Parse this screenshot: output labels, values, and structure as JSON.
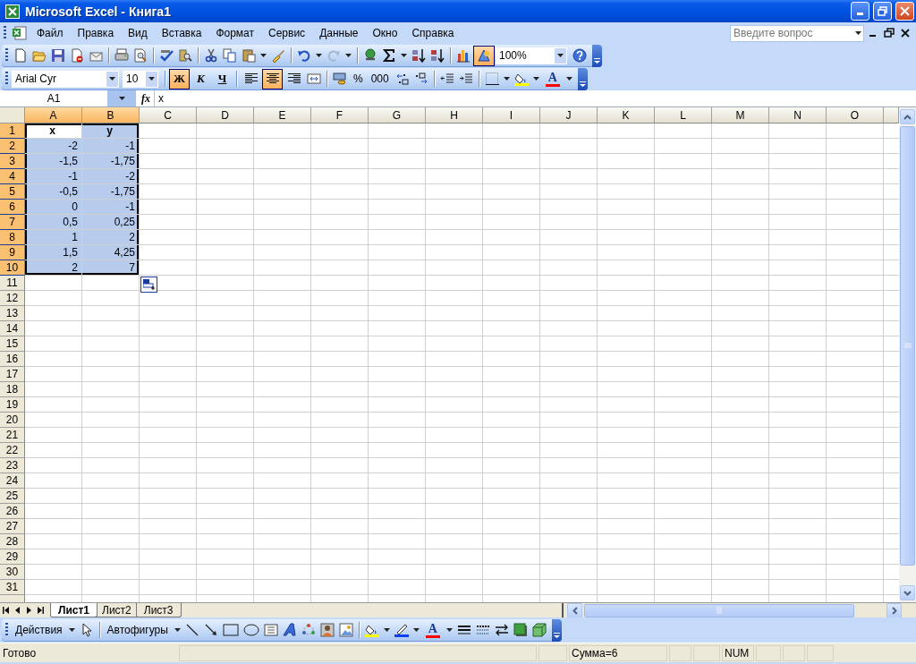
{
  "window": {
    "title": "Microsoft Excel - Книга1"
  },
  "menu": {
    "items": [
      "Файл",
      "Правка",
      "Вид",
      "Вставка",
      "Формат",
      "Сервис",
      "Данные",
      "Окно",
      "Справка"
    ],
    "help_placeholder": "Введите вопрос"
  },
  "standard_toolbar": {
    "redo_disabled": true,
    "drawing_selected": true,
    "zoom": "100%"
  },
  "formatting_toolbar": {
    "font": "Arial Cyr",
    "size": "10",
    "styles": [
      {
        "label": "Ж",
        "selected": true
      },
      {
        "label": "К",
        "selected": false
      },
      {
        "label": "Ч",
        "selected": false
      }
    ],
    "alignment": [
      {
        "kind": "left",
        "selected": false
      },
      {
        "kind": "center",
        "selected": true
      },
      {
        "kind": "right",
        "selected": false
      }
    ],
    "percent": "%",
    "thousands": "000",
    "font_color_label": "A"
  },
  "formula_bar": {
    "name_box": "A1",
    "fx": "fx",
    "value": "x"
  },
  "columns": [
    {
      "label": "A",
      "selected": true
    },
    {
      "label": "B",
      "selected": true
    },
    {
      "label": "C",
      "selected": false
    },
    {
      "label": "D",
      "selected": false
    },
    {
      "label": "E",
      "selected": false
    },
    {
      "label": "F",
      "selected": false
    },
    {
      "label": "G",
      "selected": false
    },
    {
      "label": "H",
      "selected": false
    },
    {
      "label": "I",
      "selected": false
    },
    {
      "label": "J",
      "selected": false
    },
    {
      "label": "K",
      "selected": false
    },
    {
      "label": "L",
      "selected": false
    },
    {
      "label": "M",
      "selected": false
    },
    {
      "label": "N",
      "selected": false
    },
    {
      "label": "O",
      "selected": false
    }
  ],
  "rows": [
    {
      "label": "1",
      "selected": true,
      "cells": [
        {
          "text": "x",
          "kind": "text",
          "selected": true,
          "active": true
        },
        {
          "text": "y",
          "kind": "text",
          "selected": true,
          "active": false
        }
      ]
    },
    {
      "label": "2",
      "selected": true,
      "cells": [
        {
          "text": "-2",
          "kind": "number",
          "selected": true,
          "active": false
        },
        {
          "text": "-1",
          "kind": "number",
          "selected": true,
          "active": false
        }
      ]
    },
    {
      "label": "3",
      "selected": true,
      "cells": [
        {
          "text": "-1,5",
          "kind": "number",
          "selected": true,
          "active": false
        },
        {
          "text": "-1,75",
          "kind": "number",
          "selected": true,
          "active": false
        }
      ]
    },
    {
      "label": "4",
      "selected": true,
      "cells": [
        {
          "text": "-1",
          "kind": "number",
          "selected": true,
          "active": false
        },
        {
          "text": "-2",
          "kind": "number",
          "selected": true,
          "active": false
        }
      ]
    },
    {
      "label": "5",
      "selected": true,
      "cells": [
        {
          "text": "-0,5",
          "kind": "number",
          "selected": true,
          "active": false
        },
        {
          "text": "-1,75",
          "kind": "number",
          "selected": true,
          "active": false
        }
      ]
    },
    {
      "label": "6",
      "selected": true,
      "cells": [
        {
          "text": "0",
          "kind": "number",
          "selected": true,
          "active": false
        },
        {
          "text": "-1",
          "kind": "number",
          "selected": true,
          "active": false
        }
      ]
    },
    {
      "label": "7",
      "selected": true,
      "cells": [
        {
          "text": "0,5",
          "kind": "number",
          "selected": true,
          "active": false
        },
        {
          "text": "0,25",
          "kind": "number",
          "selected": true,
          "active": false
        }
      ]
    },
    {
      "label": "8",
      "selected": true,
      "cells": [
        {
          "text": "1",
          "kind": "number",
          "selected": true,
          "active": false
        },
        {
          "text": "2",
          "kind": "number",
          "selected": true,
          "active": false
        }
      ]
    },
    {
      "label": "9",
      "selected": true,
      "cells": [
        {
          "text": "1,5",
          "kind": "number",
          "selected": true,
          "active": false
        },
        {
          "text": "4,25",
          "kind": "number",
          "selected": true,
          "active": false
        }
      ]
    },
    {
      "label": "10",
      "selected": true,
      "cells": [
        {
          "text": "2",
          "kind": "number",
          "selected": true,
          "active": false
        },
        {
          "text": "7",
          "kind": "number",
          "selected": true,
          "active": false
        }
      ]
    },
    {
      "label": "11",
      "selected": false
    },
    {
      "label": "12",
      "selected": false
    },
    {
      "label": "13",
      "selected": false
    },
    {
      "label": "14",
      "selected": false
    },
    {
      "label": "15",
      "selected": false
    },
    {
      "label": "16",
      "selected": false
    },
    {
      "label": "17",
      "selected": false
    },
    {
      "label": "18",
      "selected": false
    },
    {
      "label": "19",
      "selected": false
    },
    {
      "label": "20",
      "selected": false
    },
    {
      "label": "21",
      "selected": false
    },
    {
      "label": "22",
      "selected": false
    },
    {
      "label": "23",
      "selected": false
    },
    {
      "label": "24",
      "selected": false
    },
    {
      "label": "25",
      "selected": false
    },
    {
      "label": "26",
      "selected": false
    },
    {
      "label": "27",
      "selected": false
    },
    {
      "label": "28",
      "selected": false
    },
    {
      "label": "29",
      "selected": false
    },
    {
      "label": "30",
      "selected": false
    },
    {
      "label": "31",
      "selected": false
    }
  ],
  "sheet_tabs": [
    {
      "label": "Лист1",
      "selected": true
    },
    {
      "label": "Лист2",
      "selected": false
    },
    {
      "label": "Лист3",
      "selected": false
    }
  ],
  "drawing_toolbar": {
    "actions": "Действия",
    "autoshapes": "Автофигуры",
    "font_color_label": "A"
  },
  "status_bar": {
    "status": "Готово",
    "sum": "Сумма=6",
    "num": "NUM"
  }
}
